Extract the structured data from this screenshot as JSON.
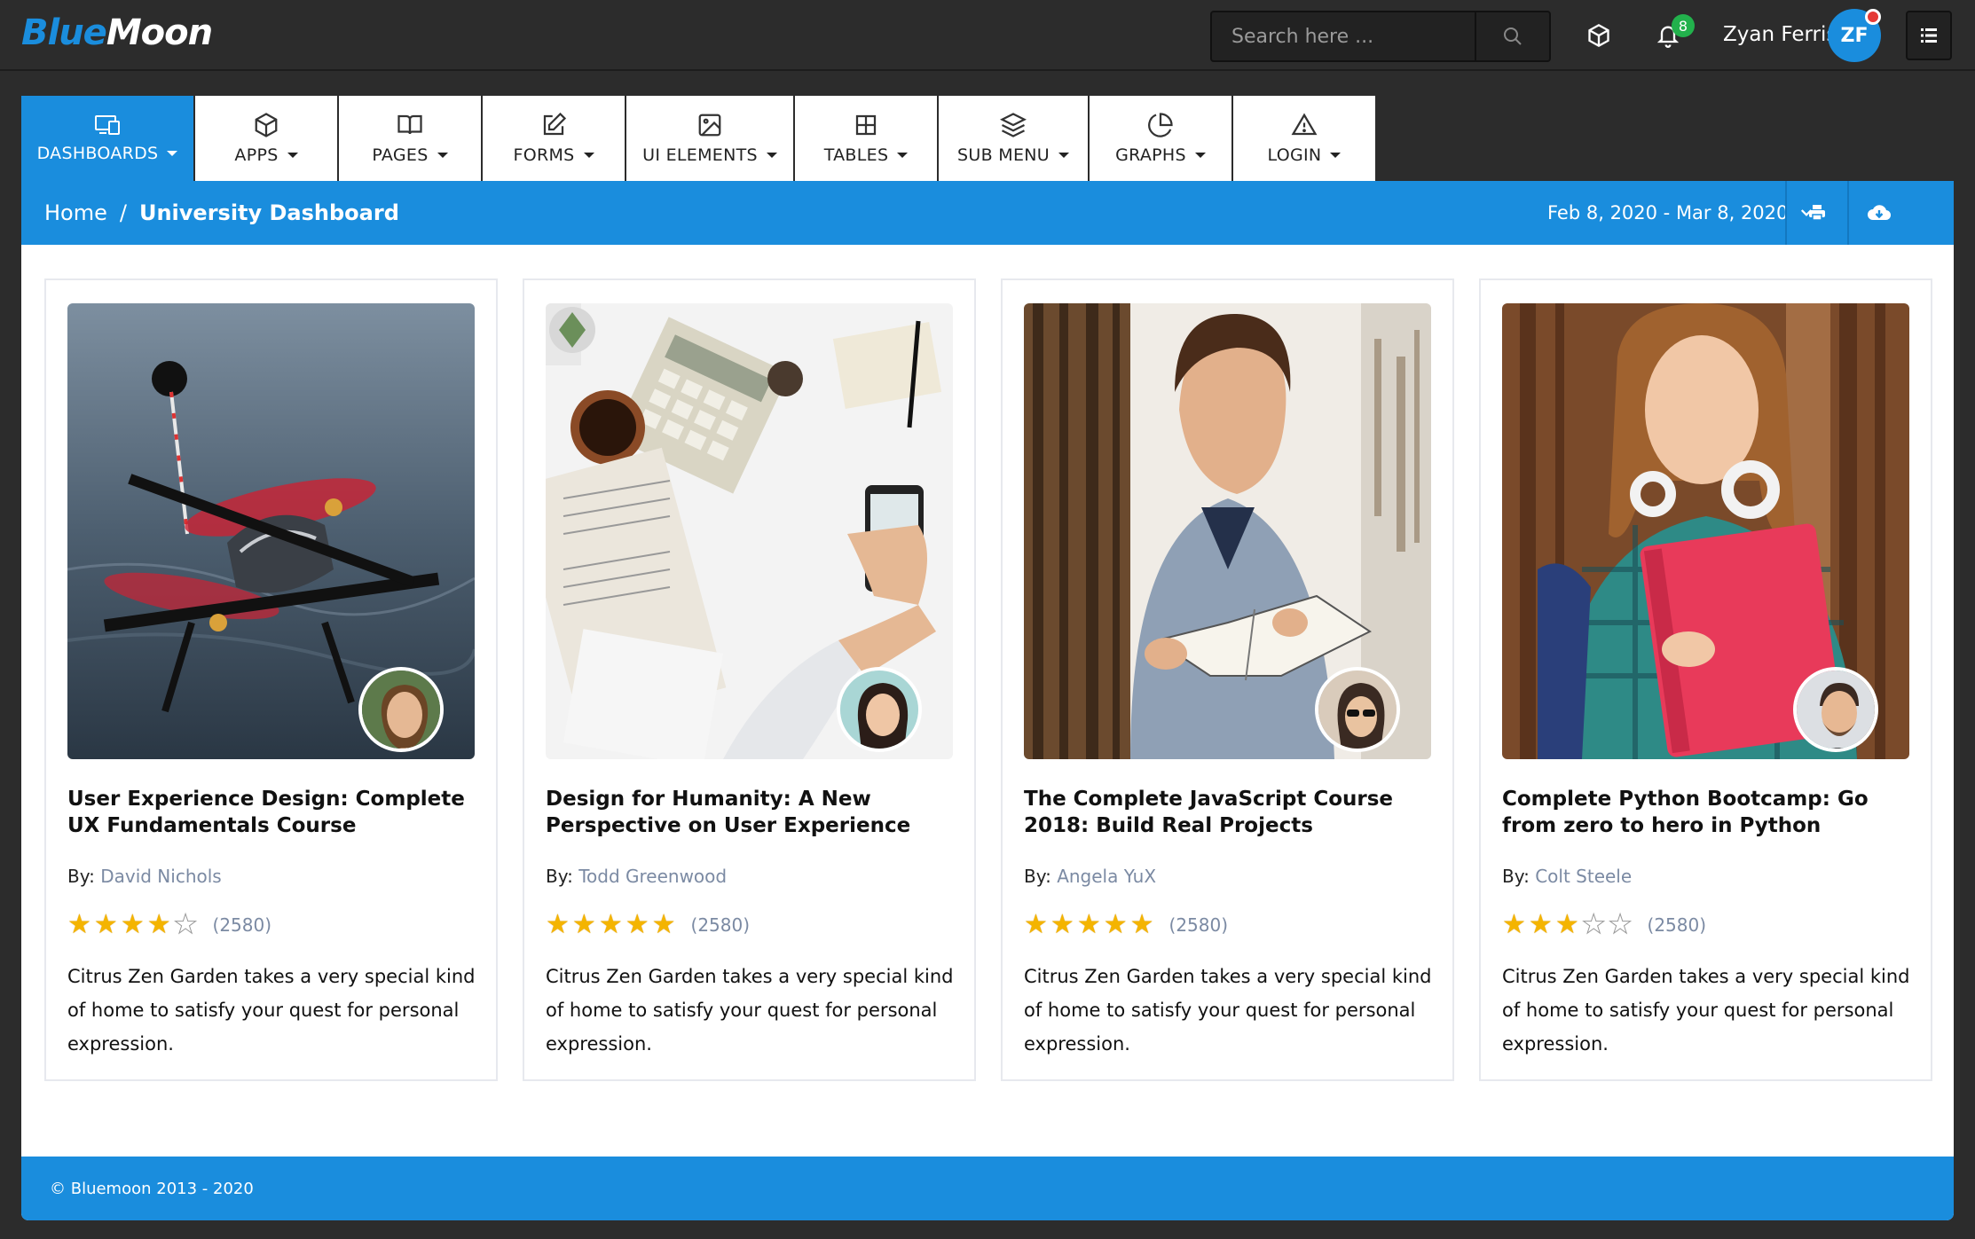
{
  "header": {
    "logo_part1": "Blue",
    "logo_part2": "Moon",
    "search_placeholder": "Search here ...",
    "notification_count": "8",
    "user_name": "Zyan Ferris",
    "user_initials": "ZF"
  },
  "nav": [
    {
      "label": "DASHBOARDS",
      "icon": "dashboard-icon",
      "active": true
    },
    {
      "label": "APPS",
      "icon": "box-icon"
    },
    {
      "label": "PAGES",
      "icon": "book-icon"
    },
    {
      "label": "FORMS",
      "icon": "edit-icon"
    },
    {
      "label": "UI ELEMENTS",
      "icon": "image-icon"
    },
    {
      "label": "TABLES",
      "icon": "grid-icon"
    },
    {
      "label": "SUB MENU",
      "icon": "layers-icon"
    },
    {
      "label": "GRAPHS",
      "icon": "pie-chart-icon"
    },
    {
      "label": "LOGIN",
      "icon": "warning-icon"
    }
  ],
  "breadcrumb": {
    "home": "Home",
    "separator": "/",
    "current": "University Dashboard",
    "date_range": "Feb 8, 2020 - Mar 8, 2020"
  },
  "cards": [
    {
      "title": "User Experience Design: Complete UX Fundamentals Course",
      "by_label": "By:",
      "author": "David Nichols",
      "stars": 4,
      "count": "(2580)",
      "description": "Citrus Zen Garden takes a very special kind of home to satisfy your quest for personal expression."
    },
    {
      "title": "Design for Humanity: A New Perspective on User Experience",
      "by_label": "By:",
      "author": "Todd Greenwood",
      "stars": 5,
      "count": "(2580)",
      "description": "Citrus Zen Garden takes a very special kind of home to satisfy your quest for personal expression."
    },
    {
      "title": "The Complete JavaScript Course 2018: Build Real Projects",
      "by_label": "By:",
      "author": "Angela YuX",
      "stars": 5,
      "count": "(2580)",
      "description": "Citrus Zen Garden takes a very special kind of home to satisfy your quest for personal expression."
    },
    {
      "title": "Complete Python Bootcamp: Go from zero to hero in Python",
      "by_label": "By:",
      "author": "Colt Steele",
      "stars": 3,
      "count": "(2580)",
      "description": "Citrus Zen Garden takes a very special kind of home to satisfy your quest for personal expression."
    }
  ],
  "footer": {
    "copyright": "© Bluemoon 2013 - 2020"
  },
  "colors": {
    "accent": "#1a8ddd",
    "header_bg": "#2c2c2c",
    "star": "#f4b400",
    "author_link": "#7b8aa3",
    "badge": "#22b14c"
  }
}
